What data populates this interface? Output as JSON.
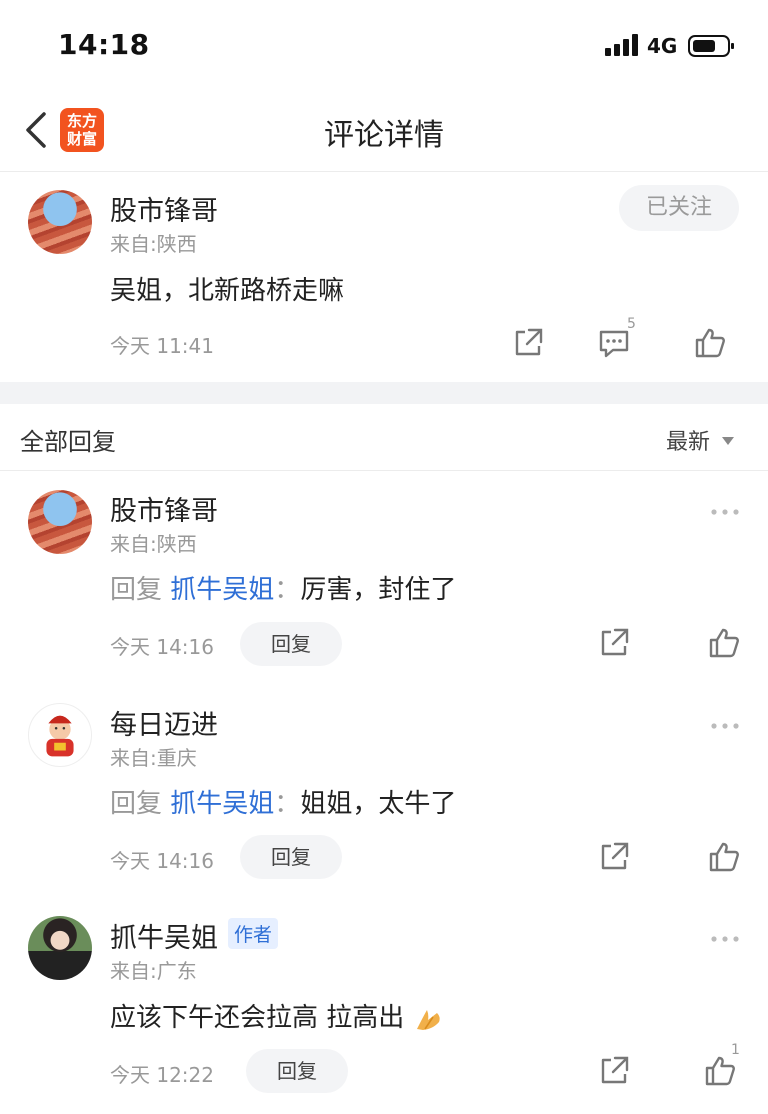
{
  "status_bar": {
    "time": "14:18",
    "network": "4G"
  },
  "nav": {
    "logo_text": "东方财富",
    "title": "评论详情"
  },
  "main_comment": {
    "user": "股市锋哥",
    "location": "来自:陕西",
    "follow_label": "已关注",
    "text": "吴姐，北新路桥走嘛",
    "time": "今天 11:41",
    "reply_count": "5"
  },
  "replies_section": {
    "title": "全部回复",
    "sort": "最新"
  },
  "replies": [
    {
      "user": "股市锋哥",
      "location": "来自:陕西",
      "prefix": "回复",
      "target": "抓牛吴姐",
      "colon": "：",
      "text": "厉害，封住了",
      "time": "今天 14:16",
      "reply_label": "回复"
    },
    {
      "user": "每日迈进",
      "location": "来自:重庆",
      "prefix": "回复",
      "target": "抓牛吴姐",
      "colon": "：",
      "text": "姐姐，太牛了",
      "time": "今天 14:16",
      "reply_label": "回复"
    },
    {
      "user": "抓牛吴姐",
      "badge": "作者",
      "location": "来自:广东",
      "text": "应该下午还会拉高 拉高出",
      "time": "今天 12:22",
      "reply_label": "回复",
      "like_count": "1"
    }
  ]
}
